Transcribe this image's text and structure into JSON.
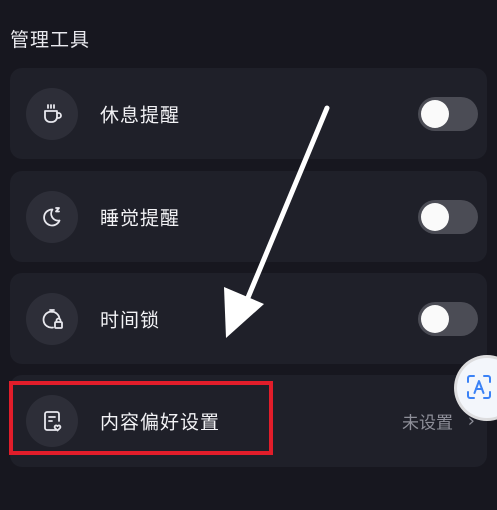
{
  "section": {
    "title": "管理工具"
  },
  "items": [
    {
      "label": "休息提醒",
      "icon": "coffee-cup-icon",
      "toggle": false
    },
    {
      "label": "睡觉提醒",
      "icon": "moon-icon",
      "toggle": false
    },
    {
      "label": "时间锁",
      "icon": "timer-lock-icon",
      "toggle": false
    },
    {
      "label": "内容偏好设置",
      "icon": "document-heart-icon",
      "value": "未设置",
      "chevron": "›"
    }
  ],
  "colors": {
    "background": "#17171f",
    "card": "#1f2029",
    "toggle_off": "#4b4c55",
    "highlight": "#e11d2a",
    "float_icon": "#3b82f6"
  }
}
